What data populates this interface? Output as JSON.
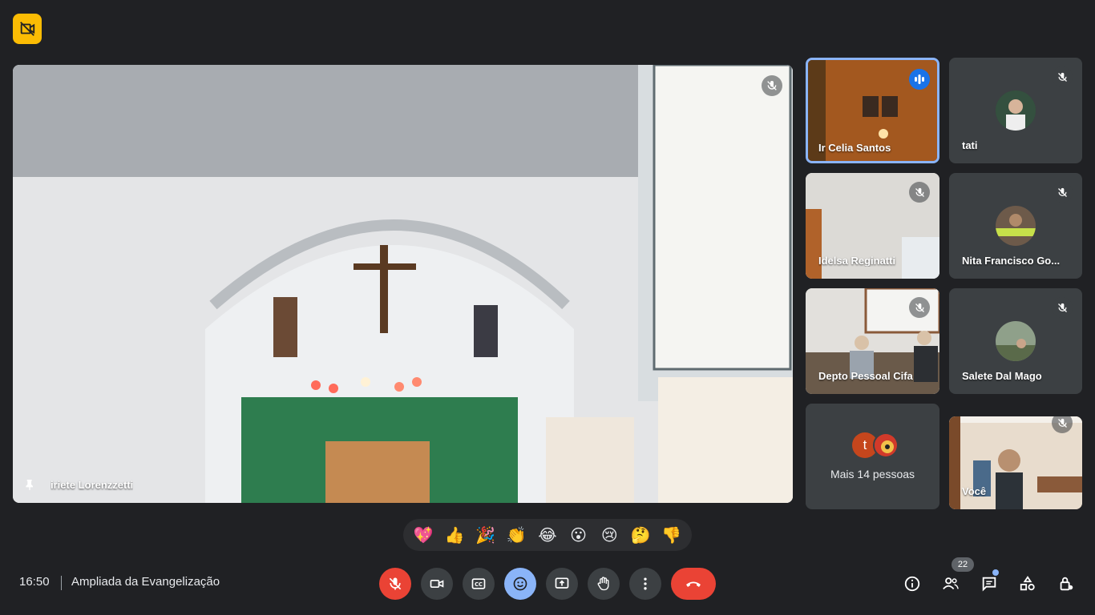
{
  "meeting": {
    "time": "16:50",
    "title": "Ampliada da Evangelização"
  },
  "main_video": {
    "name": "iriete Lorenzzetti"
  },
  "participants": [
    {
      "name": "Ir Celia Santos",
      "speaking": true
    },
    {
      "name": "tati",
      "muted": true
    },
    {
      "name": "Idelsa Reginatti",
      "muted": true
    },
    {
      "name": "Nita Francisco Go...",
      "muted": true
    },
    {
      "name": "Depto Pessoal Cifa",
      "muted": true
    },
    {
      "name": "Salete Dal Mago",
      "muted": true
    },
    {
      "name": "Você",
      "muted": true
    }
  ],
  "more_people": {
    "label": "Mais 14 pessoas",
    "avatar_letter": "t"
  },
  "reactions": [
    "💖",
    "👍",
    "🎉",
    "👏",
    "😂",
    "😮",
    "😢",
    "🤔",
    "👎"
  ],
  "people_count": "22",
  "colors": {
    "background": "#202124",
    "end_call": "#ea4335",
    "mic_off": "#ea4335",
    "reaction_active": "#8ab4f8",
    "badge": "#fbbc04",
    "speaking_border": "#8ab4f8"
  }
}
